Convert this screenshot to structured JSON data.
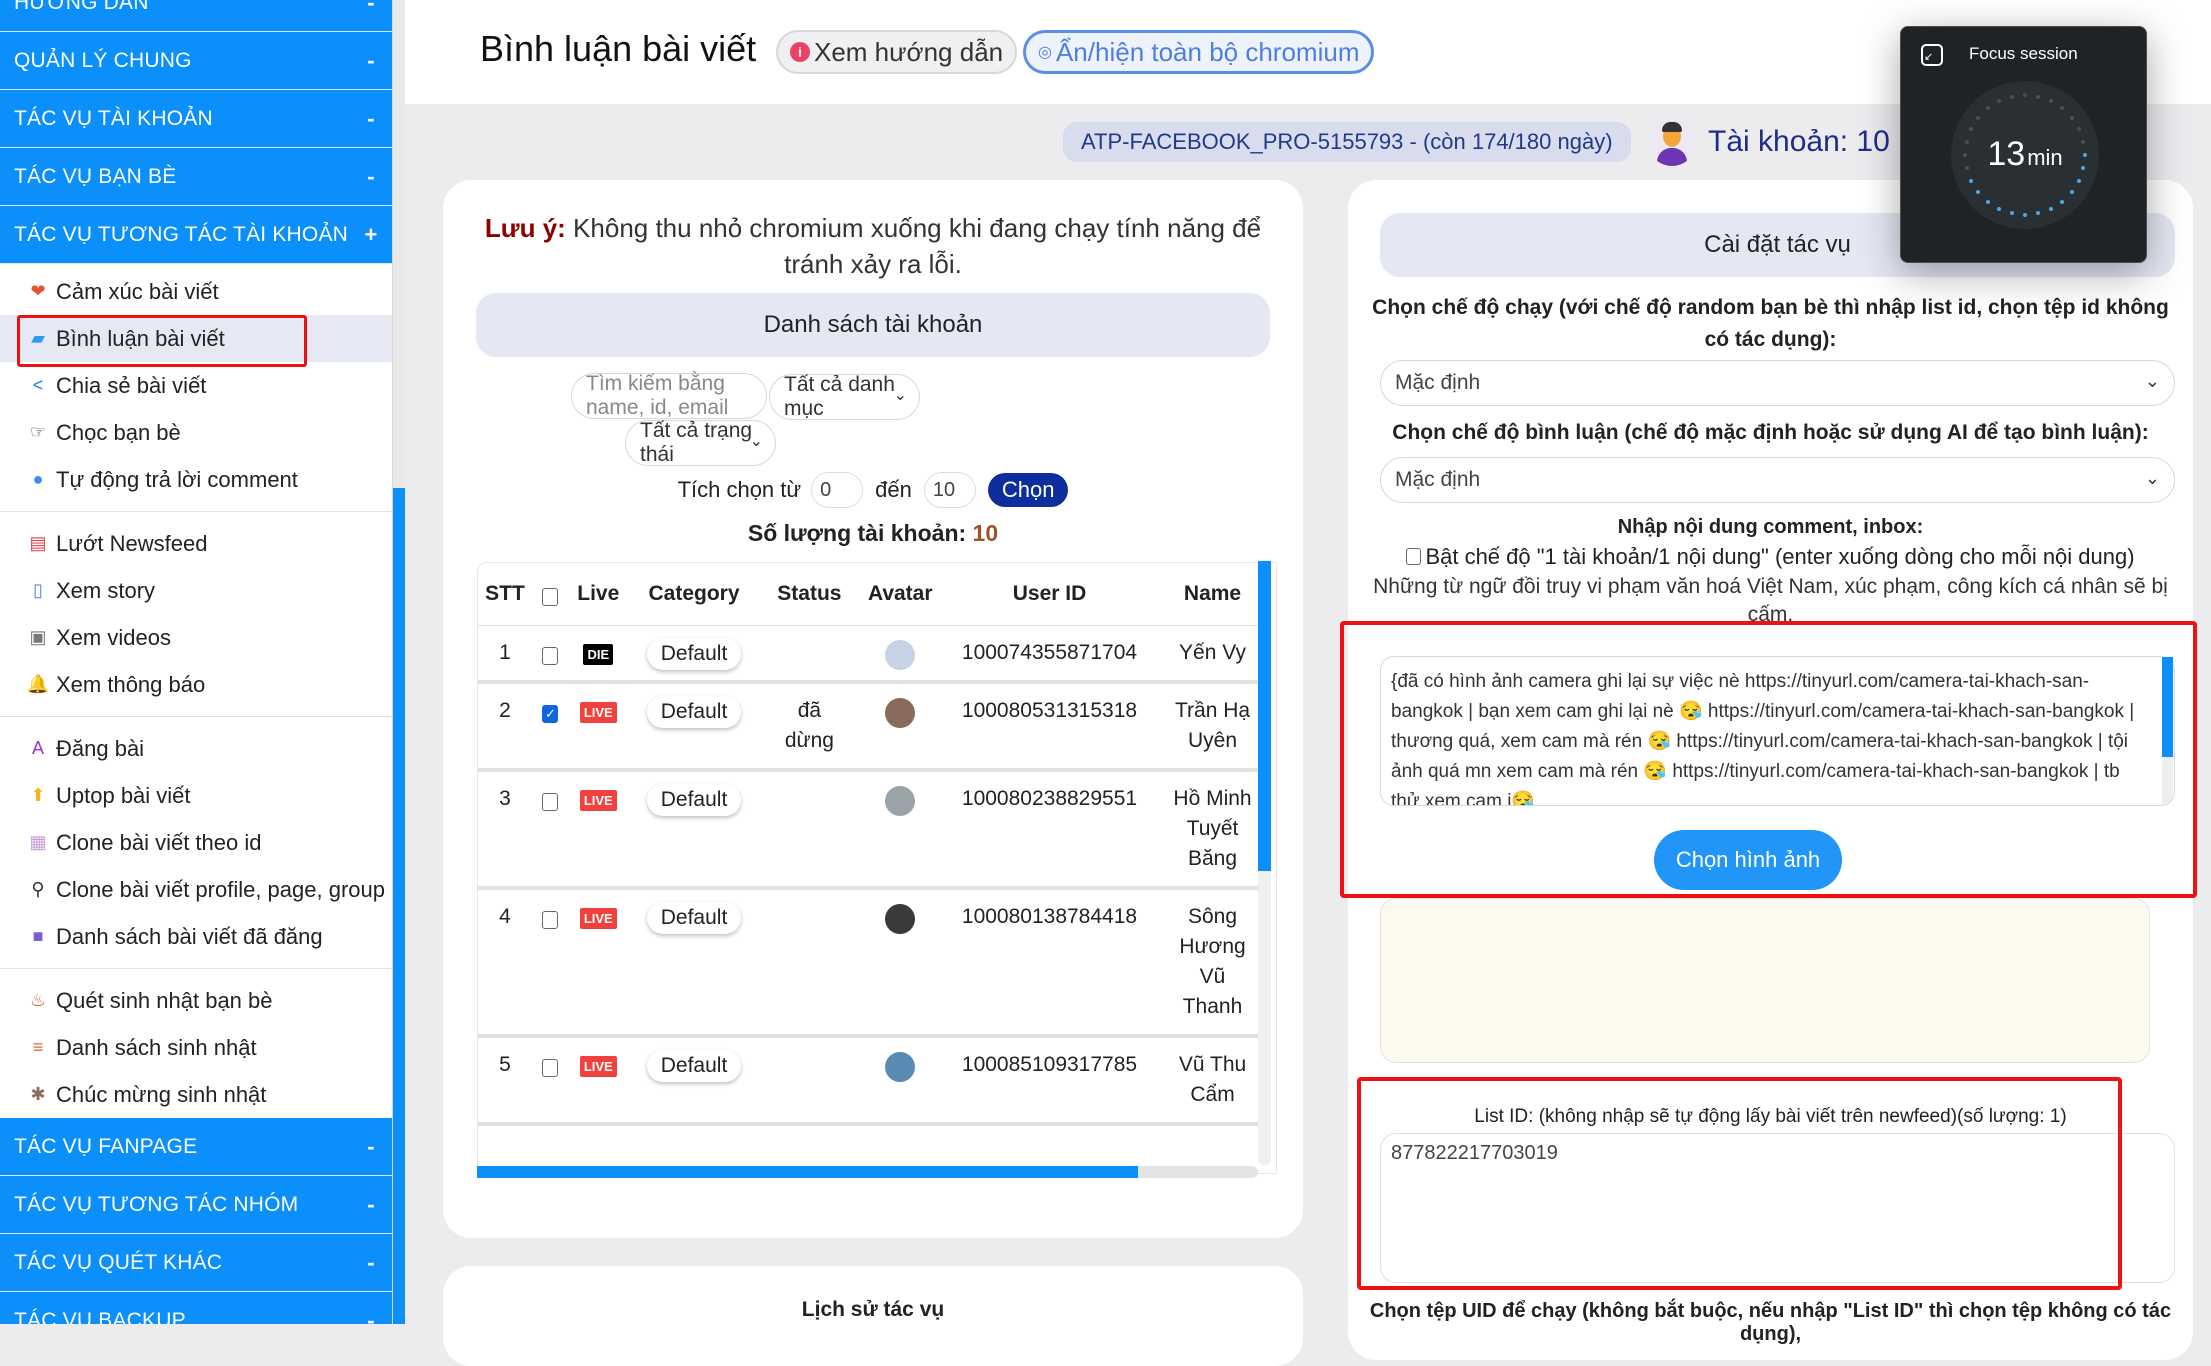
{
  "sidebar": {
    "groups_top": [
      {
        "label": "HƯỚNG DẪN",
        "sign": "-"
      },
      {
        "label": "QUẢN LÝ CHUNG",
        "sign": "-"
      },
      {
        "label": "TÁC VỤ TÀI KHOẢN",
        "sign": "-"
      },
      {
        "label": "TÁC VỤ BẠN BÈ",
        "sign": "-"
      },
      {
        "label": "TÁC VỤ TƯƠNG TÁC TÀI KHOẢN",
        "sign": "+"
      }
    ],
    "sections": [
      [
        {
          "label": "Cảm xúc bài viết",
          "icon": "heart-reaction-icon",
          "glyph": "❤",
          "color": "#e8532f"
        },
        {
          "label": "Bình luận bài viết",
          "icon": "comment-icon",
          "glyph": "▰",
          "color": "#2d9df0",
          "active": true
        },
        {
          "label": "Chia sẻ bài viết",
          "icon": "share-icon",
          "glyph": "<",
          "color": "#1f7be0"
        },
        {
          "label": "Chọc bạn bè",
          "icon": "poke-hand-icon",
          "glyph": "☞",
          "color": "#444"
        },
        {
          "label": "Tự động trả lời comment",
          "icon": "auto-reply-icon",
          "glyph": "●",
          "color": "#3a8ee6"
        }
      ],
      [
        {
          "label": "Lướt Newsfeed",
          "icon": "newsfeed-icon",
          "glyph": "▤",
          "color": "#e03a3e"
        },
        {
          "label": "Xem story",
          "icon": "story-icon",
          "glyph": "▯",
          "color": "#5a7bd6"
        },
        {
          "label": "Xem videos",
          "icon": "video-icon",
          "glyph": "▣",
          "color": "#777"
        },
        {
          "label": "Xem thông báo",
          "icon": "notification-bell-icon",
          "glyph": "🔔",
          "color": "#f5a623"
        }
      ],
      [
        {
          "label": "Đăng bài",
          "icon": "post-icon",
          "glyph": "A",
          "color": "#9b30d9"
        },
        {
          "label": "Uptop bài viết",
          "icon": "uptop-icon",
          "glyph": "⬆",
          "color": "#f8b41a"
        },
        {
          "label": "Clone bài viết theo id",
          "icon": "clone-id-icon",
          "glyph": "▦",
          "color": "#c49bd8"
        },
        {
          "label": "Clone bài viết profile, page, group",
          "icon": "clone-profile-icon",
          "glyph": "⚲",
          "color": "#333"
        },
        {
          "label": "Danh sách bài viết đã đăng",
          "icon": "posted-list-icon",
          "glyph": "■",
          "color": "#7d5bd6"
        }
      ],
      [
        {
          "label": "Quét sinh nhật bạn bè",
          "icon": "birthday-scan-icon",
          "glyph": "♨",
          "color": "#e05a2a"
        },
        {
          "label": "Danh sách sinh nhật",
          "icon": "birthday-list-icon",
          "glyph": "≡",
          "color": "#e06b2a"
        },
        {
          "label": "Chúc mừng sinh nhật",
          "icon": "birthday-wish-icon",
          "glyph": "✱",
          "color": "#8a6d5a"
        }
      ]
    ],
    "groups_bottom": [
      {
        "label": "TÁC VỤ FANPAGE",
        "sign": "-"
      },
      {
        "label": "TÁC VỤ TƯƠNG TÁC NHÓM",
        "sign": "-"
      },
      {
        "label": "TÁC VỤ QUÉT KHÁC",
        "sign": "-"
      },
      {
        "label": "TÁC VỤ BACKUP",
        "sign": "-"
      }
    ]
  },
  "header": {
    "title": "Bình luận bài viết",
    "guide_button": "Xem hướng dẫn",
    "chromium_button": "Ẩn/hiện toàn bộ chromium",
    "license": "ATP-FACEBOOK_PRO-5155793 - (còn 174/180 ngày)",
    "account_count": "Tài khoản: 10"
  },
  "accounts_panel": {
    "note_label": "Lưu ý:",
    "note_text": " Không thu nhỏ chromium xuống khi đang chạy tính năng để tránh xảy ra lỗi.",
    "title": "Danh sách tài khoản",
    "search_placeholder": "Tìm kiếm bằng name, id, email",
    "category_select": "Tất cả danh mục",
    "status_select": "Tất cả trạng thái",
    "range_label": "Tích chọn từ",
    "range_from": "0",
    "range_to_label": "đến",
    "range_to": "10",
    "choose_button": "Chọn",
    "count_label": "Số lượng tài khoản:",
    "count_value": "10",
    "table": {
      "headers": [
        "STT",
        "",
        "Live",
        "Category",
        "Status",
        "Avatar",
        "User ID",
        "Name"
      ],
      "rows": [
        {
          "stt": "1",
          "checked": false,
          "live": "DIE",
          "category": "Default",
          "status": "",
          "avatar_color": "#c8d2e6",
          "user_id": "100074355871704",
          "name": "Yến Vy"
        },
        {
          "stt": "2",
          "checked": true,
          "live": "LIVE",
          "category": "Default",
          "status": "đã dừng",
          "avatar_color": "#8a6a5a",
          "user_id": "100080531315318",
          "name": "Trần Hạ Uyên"
        },
        {
          "stt": "3",
          "checked": false,
          "live": "LIVE",
          "category": "Default",
          "status": "",
          "avatar_color": "#9aa4a8",
          "user_id": "100080238829551",
          "name": "Hồ Minh Tuyết Băng"
        },
        {
          "stt": "4",
          "checked": false,
          "live": "LIVE",
          "category": "Default",
          "status": "",
          "avatar_color": "#3a3a3a",
          "user_id": "100080138784418",
          "name": "Sông Hương Vũ Thanh"
        },
        {
          "stt": "5",
          "checked": false,
          "live": "LIVE",
          "category": "Default",
          "status": "",
          "avatar_color": "#5a8ab4",
          "user_id": "100085109317785",
          "name": "Vũ Thu Cẩm"
        }
      ]
    }
  },
  "history_panel": {
    "title": "Lịch sử tác vụ"
  },
  "settings_panel": {
    "title": "Cài đặt tác vụ",
    "run_mode_label": "Chọn chế độ chạy (với chế độ random bạn bè thì nhập list id, chọn tệp id không có tác dụng):",
    "run_mode_value": "Mặc định",
    "comment_mode_label": "Chọn chế độ bình luận (chế độ mặc định hoặc sử dụng AI để tạo bình luận):",
    "comment_mode_value": "Mặc định",
    "content_label": "Nhập nội dung comment, inbox:",
    "one_per_account_label": "Bật chế độ \"1 tài khoản/1 nội dung\" (enter xuống dòng cho mỗi nội dung)",
    "one_per_account_checked": false,
    "warning": "Những từ ngữ đồi truy vi phạm văn hoá Việt Nam, xúc phạm, công kích cá nhân sẽ bị cấm.",
    "comment_content": "{đã có hình ảnh camera ghi lại sự việc nè https://tinyurl.com/camera-tai-khach-san-bangkok | bạn xem cam ghi lại nè 😪 https://tinyurl.com/camera-tai-khach-san-bangkok | thương quá, xem cam mà rén 😪 https://tinyurl.com/camera-tai-khach-san-bangkok | tội ảnh quá mn xem cam mà rén 😪 https://tinyurl.com/camera-tai-khach-san-bangkok | tb thử xem cam i😪",
    "choose_image_button": "Chọn hình ảnh",
    "list_id_label": "List ID: (không nhập sẽ tự động lấy bài viết trên newfeed)(số lượng: 1)",
    "list_id_value": "877822217703019",
    "uid_file_label": "Chọn tệp UID để chạy (không bắt buộc, nếu nhập \"List ID\" thì chọn tệp không có tác dụng),"
  },
  "focus_session": {
    "title": "Focus session",
    "minutes": "13",
    "unit": "min",
    "remaining_fraction": 0.45
  },
  "colors": {
    "accent": "#0a8ffb",
    "live": "#f0413f",
    "die": "#000000",
    "highlight": "#ee1111",
    "choose": "#0d2e9c"
  }
}
